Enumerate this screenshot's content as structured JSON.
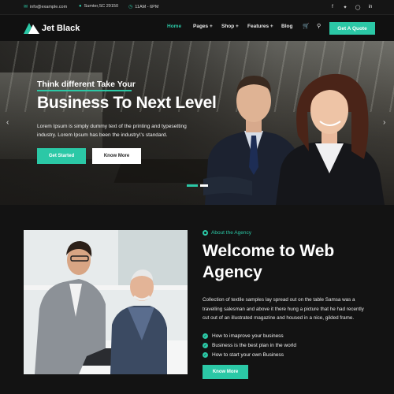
{
  "topbar": {
    "email": "info@example.com",
    "address": "Sumter,SC 29150",
    "hours": "11AM - 6PM",
    "social_icons": [
      "facebook-icon",
      "twitter-icon",
      "instagram-icon",
      "linkedin-icon"
    ]
  },
  "nav": {
    "logo_text": "Jet Black",
    "items": [
      "Home",
      "Pages +",
      "Shop +",
      "Features +",
      "Blog"
    ],
    "active_item": "Home",
    "cta_label": "Get A Quote"
  },
  "hero": {
    "subtitle": "Think different Take Your",
    "title": "Business To Next Level",
    "text": "Lorem Ipsum is simply dummy text of the printing and typesetting industry. Lorem Ipsum has been the industry\\'s standard.",
    "primary_button": "Get Started",
    "secondary_button": "Know More",
    "slide_count": 2,
    "active_slide": 1
  },
  "about": {
    "label": "About the Agency",
    "title": "Welcome to Web Agency",
    "text": "Collection of textile samples lay spread out on the table Samsa was a travelling salesman and above it there hung a picture that he had recently cut out of an illustrated magazine and housed in a nice, gilded frame.",
    "checklist": [
      "How to imaprove your business",
      "Business is the best plan in the world",
      "How to start your own Business"
    ],
    "button": "Know More"
  },
  "colors": {
    "accent": "#2bc8a6",
    "background": "#131313"
  }
}
